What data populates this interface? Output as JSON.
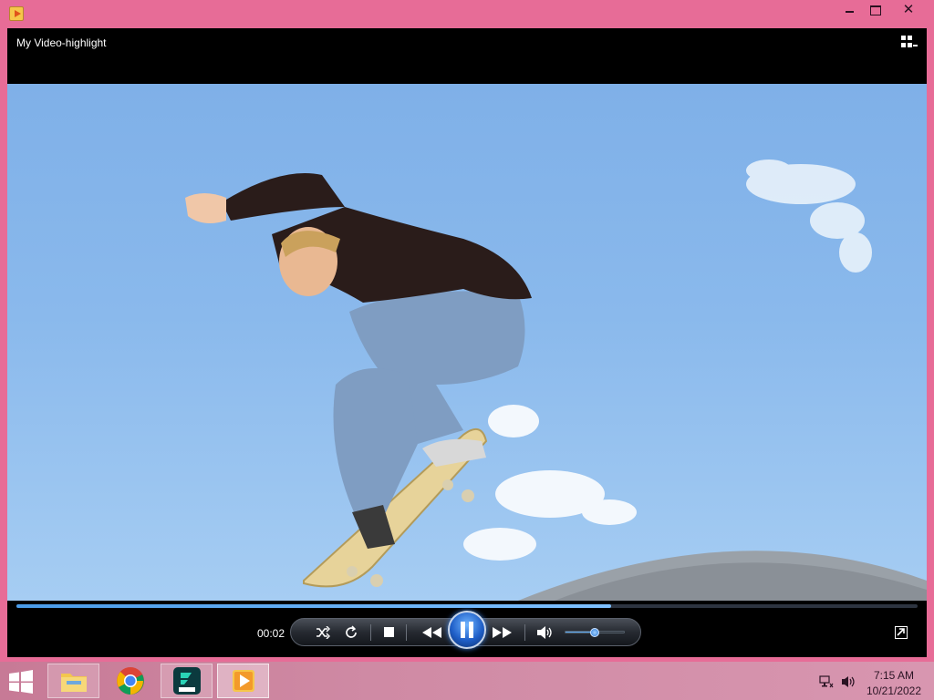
{
  "window": {
    "title": "",
    "close_label": "✕"
  },
  "player": {
    "title": "My Video-highlight",
    "current_time": "00:02",
    "seek_progress": 0.66,
    "volume_level": 0.5,
    "state": "playing"
  },
  "controls": {
    "shuffle_icon": "shuffle-icon",
    "repeat_icon": "repeat-icon",
    "stop_icon": "stop-icon",
    "previous_icon": "rewind-icon",
    "pause_icon": "pause-icon",
    "next_icon": "fast-forward-icon",
    "mute_icon": "speaker-icon",
    "fullscreen_icon": "fullscreen-icon"
  },
  "taskbar": {
    "pinned": [
      "file-explorer-icon",
      "chrome-icon",
      "filmora-icon",
      "media-player-icon"
    ],
    "active_app": "media-player-icon",
    "clock_time": "7:15 AM",
    "clock_date": "10/21/2022"
  },
  "colors": {
    "window_frame": "#e76c97",
    "accent_blue": "#3a8ee8",
    "taskbar": "#cf8aa4"
  }
}
